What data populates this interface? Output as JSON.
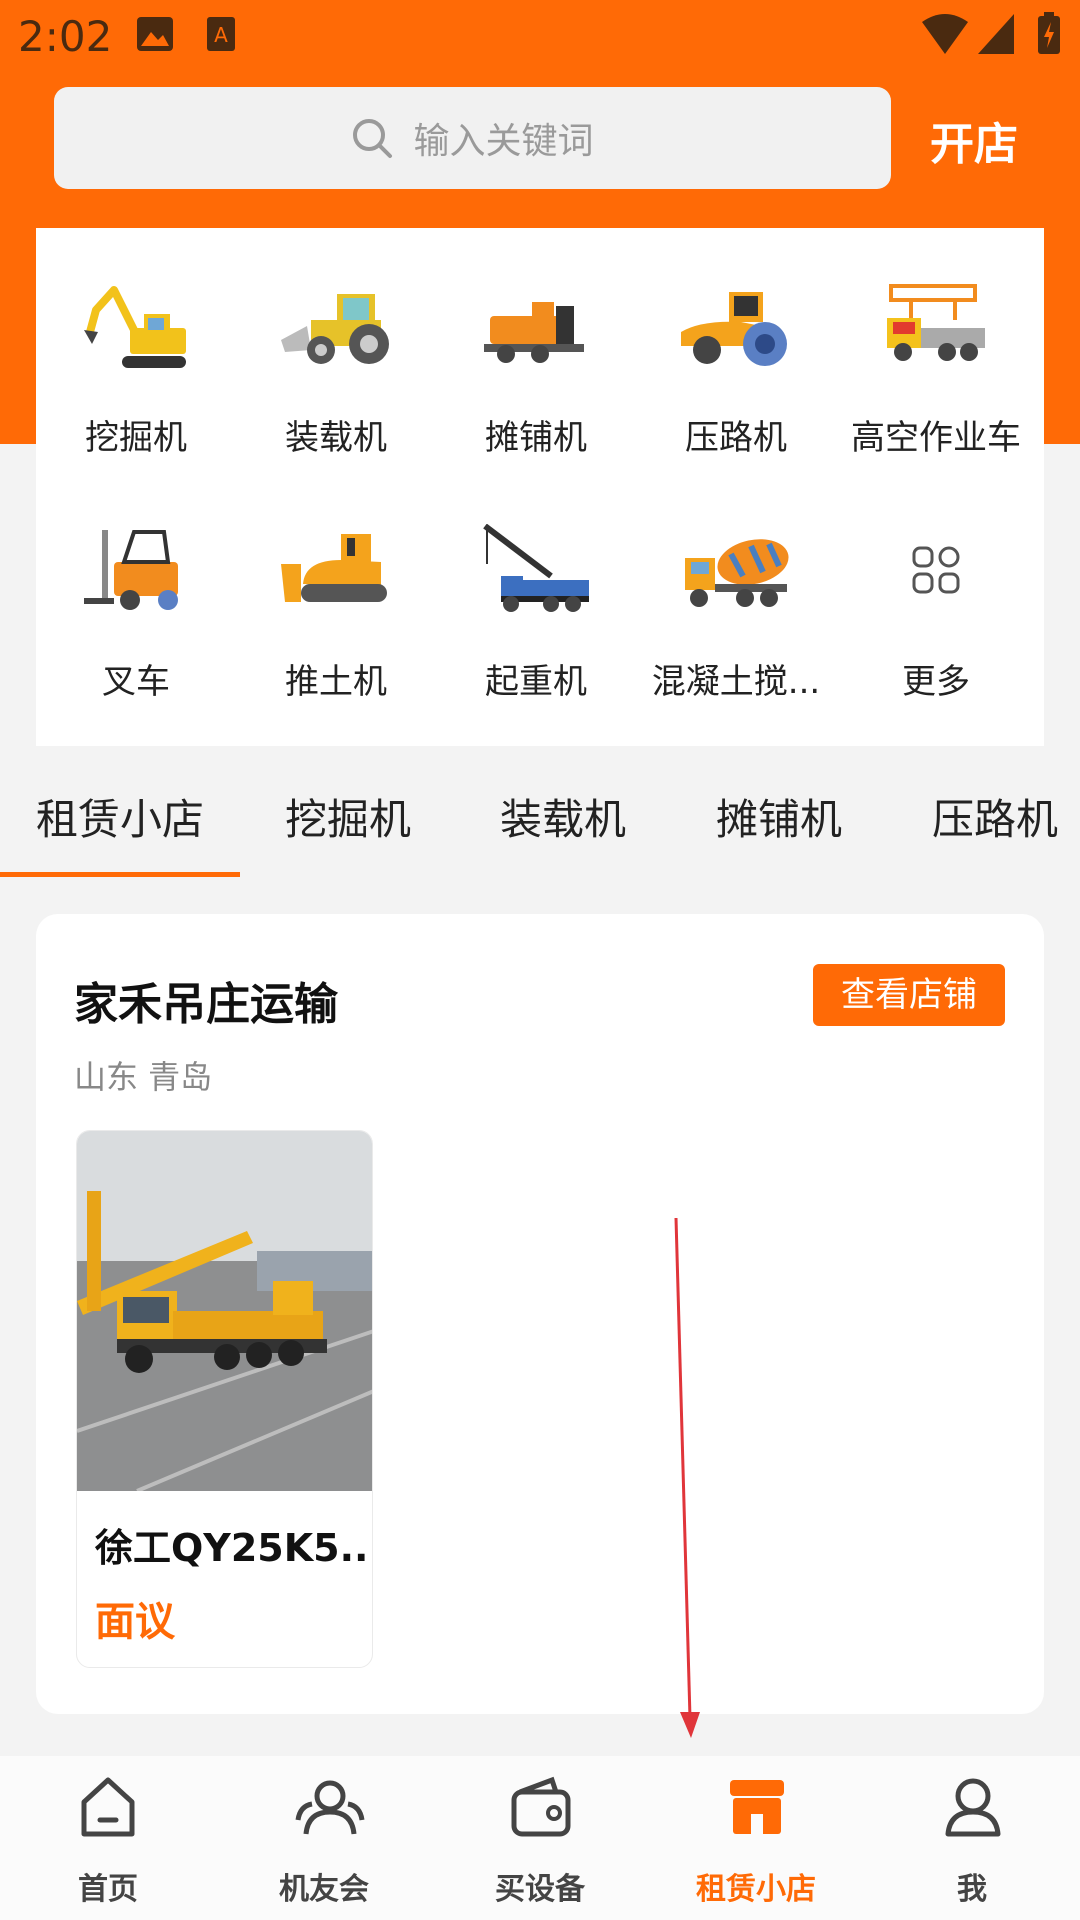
{
  "status_bar": {
    "time": "2:02"
  },
  "header": {
    "search_placeholder": "输入关键词",
    "open_shop": "开店"
  },
  "categories": [
    {
      "label": "挖掘机",
      "icon": "excavator-icon"
    },
    {
      "label": "装载机",
      "icon": "loader-icon"
    },
    {
      "label": "摊铺机",
      "icon": "paver-icon"
    },
    {
      "label": "压路机",
      "icon": "road-roller-icon"
    },
    {
      "label": "高空作业车",
      "icon": "aerial-work-truck-icon"
    },
    {
      "label": "叉车",
      "icon": "forklift-icon"
    },
    {
      "label": "推土机",
      "icon": "bulldozer-icon"
    },
    {
      "label": "起重机",
      "icon": "crane-icon"
    },
    {
      "label": "混凝土搅...",
      "icon": "concrete-mixer-icon"
    },
    {
      "label": "更多",
      "icon": "more-grid-icon"
    }
  ],
  "tabs": [
    "租赁小店",
    "挖掘机",
    "装载机",
    "摊铺机",
    "压路机"
  ],
  "active_tab": "租赁小店",
  "shop": {
    "name": "家禾吊庄运输",
    "location": "山东 青岛",
    "view_button": "查看店铺",
    "product": {
      "title": "徐工QY25K5...",
      "price": "面议"
    }
  },
  "bottom_nav": [
    {
      "label": "首页",
      "icon": "home-icon"
    },
    {
      "label": "机友会",
      "icon": "community-icon"
    },
    {
      "label": "买设备",
      "icon": "wallet-icon"
    },
    {
      "label": "租赁小店",
      "icon": "shop-icon"
    },
    {
      "label": "我",
      "icon": "profile-icon"
    }
  ],
  "colors": {
    "brand": "#ff6a06",
    "background": "#f3f3f3"
  }
}
